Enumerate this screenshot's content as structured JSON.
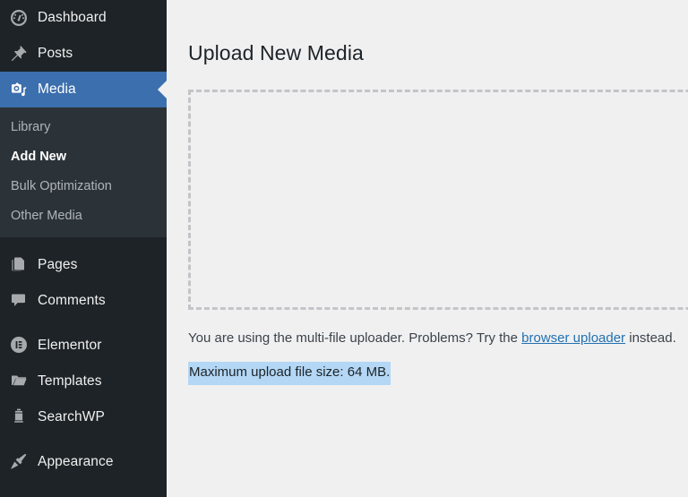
{
  "sidebar": {
    "items": [
      {
        "label": "Dashboard",
        "icon": "dashboard-gauge-icon",
        "active": false
      },
      {
        "label": "Posts",
        "icon": "pin-icon",
        "active": false
      },
      {
        "label": "Media",
        "icon": "camera-media-icon",
        "active": true
      },
      {
        "label": "Pages",
        "icon": "pages-icon",
        "active": false
      },
      {
        "label": "Comments",
        "icon": "comment-bubble-icon",
        "active": false
      },
      {
        "label": "Elementor",
        "icon": "elementor-icon",
        "active": false
      },
      {
        "label": "Templates",
        "icon": "folder-icon",
        "active": false
      },
      {
        "label": "SearchWP",
        "icon": "lantern-icon",
        "active": false
      },
      {
        "label": "Appearance",
        "icon": "paintbrush-icon",
        "active": false
      }
    ],
    "submenu": [
      {
        "label": "Library",
        "current": false
      },
      {
        "label": "Add New",
        "current": true
      },
      {
        "label": "Bulk Optimization",
        "current": false
      },
      {
        "label": "Other Media",
        "current": false
      }
    ]
  },
  "main": {
    "page_title": "Upload New Media",
    "uploader_note_prefix": "You are using the multi-file uploader. Problems? Try the ",
    "uploader_link": "browser uploader",
    "uploader_note_suffix": " instead.",
    "max_upload_text": "Maximum upload file size: 64 MB."
  },
  "colors": {
    "sidebar_bg": "#1d2327",
    "submenu_bg": "#2c3338",
    "active_blue": "#3c6fad",
    "link_blue": "#2271b1",
    "content_bg": "#f0f0f1",
    "dropzone_border": "#c3c4c7",
    "selection_highlight": "#b3d7f5"
  }
}
